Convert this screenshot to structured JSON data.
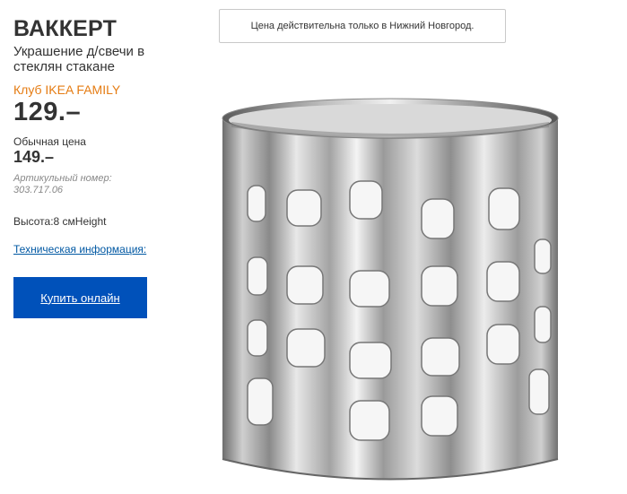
{
  "product": {
    "name": "ВАККЕРТ",
    "description": "Украшение д/свечи в стеклян стакане",
    "family_label": "Клуб IKEA FAMILY",
    "family_price": "129.–",
    "regular_label": "Обычная цена",
    "regular_price": "149.–",
    "article_label": "Артикульный номер:",
    "article_number": "303.717.06",
    "height_line": "Высота:8 смHeight",
    "tech_info_link": "Техническая информация:",
    "buy_button": "Купить онлайн"
  },
  "notice": {
    "text": "Цена действительна только в Нижний Новгород."
  },
  "colors": {
    "family_orange": "#e57c13",
    "button_blue": "#0051ba",
    "link_blue": "#0058a3"
  },
  "image": {
    "icon": "metal-candle-holder-photo"
  }
}
